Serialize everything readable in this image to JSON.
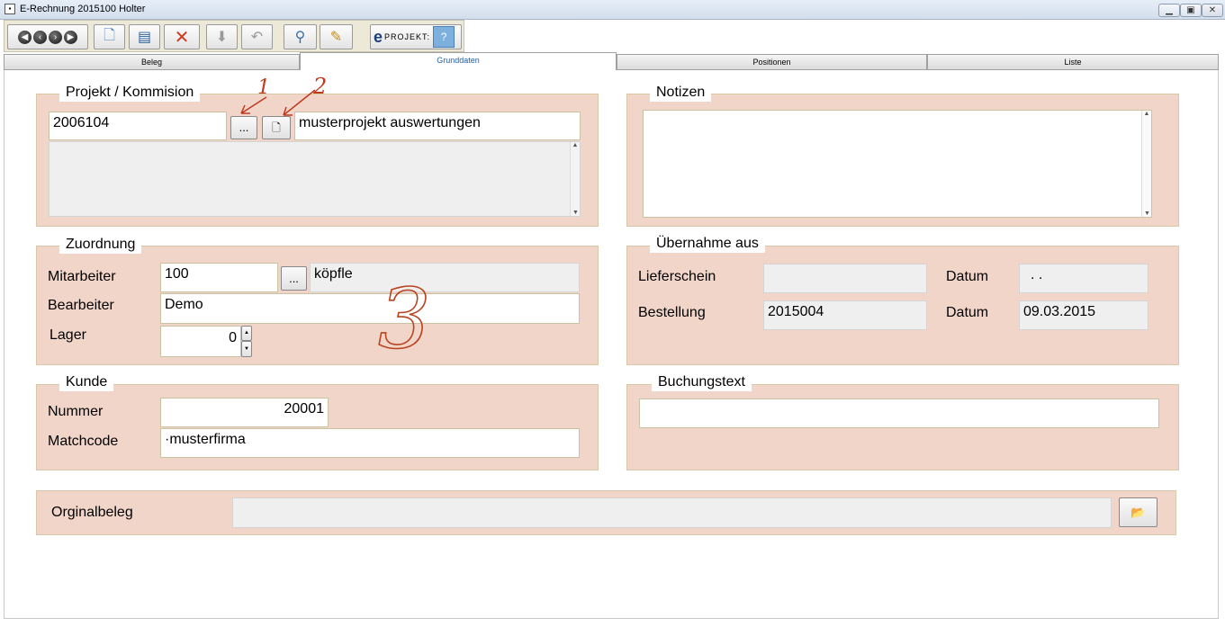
{
  "window": {
    "title": "E-Rechnung  2015100  Holter",
    "app_icon": "app-icon"
  },
  "tabs": [
    {
      "label": "Beleg",
      "active": false
    },
    {
      "label": "Grunddaten",
      "active": true
    },
    {
      "label": "Positionen",
      "active": false
    },
    {
      "label": "Liste",
      "active": false
    }
  ],
  "toolbar": {
    "logo_e": "e",
    "logo_text": "PROJEKT:"
  },
  "projekt": {
    "legend": "Projekt / Kommision",
    "number": "2006104",
    "browse_label": "...",
    "description": "musterprojekt auswertungen",
    "memo": ""
  },
  "notizen": {
    "legend": "Notizen",
    "text": ""
  },
  "zuordnung": {
    "legend": "Zuordnung",
    "mitarbeiter_label": "Mitarbeiter",
    "mitarbeiter_value": "100",
    "mitarbeiter_browse": "...",
    "mitarbeiter_name": "köpfle",
    "bearbeiter_label": "Bearbeiter",
    "bearbeiter_value": "Demo",
    "lager_label": "Lager",
    "lager_value": "0"
  },
  "uebernahme": {
    "legend": "Übernahme aus",
    "lieferschein_label": "Lieferschein",
    "lieferschein_value": "",
    "datum1_label": "Datum",
    "datum1_value": ".  .",
    "bestellung_label": "Bestellung",
    "bestellung_value": "2015004",
    "datum2_label": "Datum",
    "datum2_value": "09.03.2015"
  },
  "kunde": {
    "legend": "Kunde",
    "nummer_label": "Nummer",
    "nummer_value": "20001",
    "matchcode_label": "Matchcode",
    "matchcode_value": "·musterfirma"
  },
  "buchungstext": {
    "legend": "Buchungstext",
    "value": ""
  },
  "orginalbeleg": {
    "label": "Orginalbeleg",
    "value": ""
  },
  "annotations": {
    "one": "1",
    "two": "2",
    "three": "3"
  }
}
